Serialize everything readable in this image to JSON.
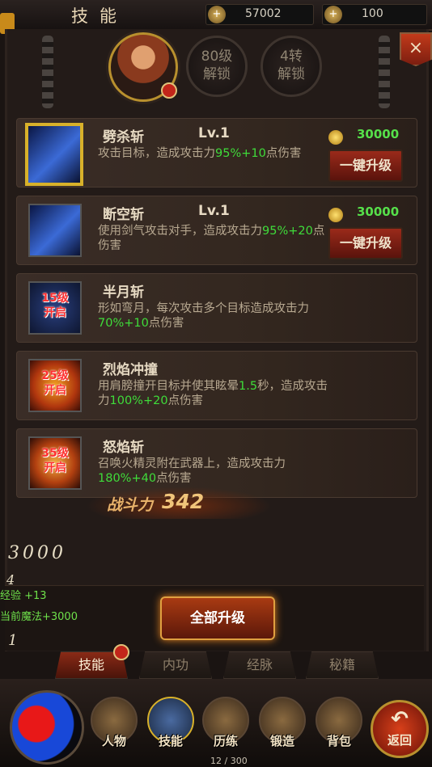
{
  "header": {
    "title": "技能",
    "gold": "57002",
    "ingot": "100",
    "add_sign": "+"
  },
  "hero": {
    "unlock_level": [
      "80级",
      "解锁"
    ],
    "unlock_rebirth": [
      "4转",
      "解锁"
    ],
    "close": "×"
  },
  "skills": [
    {
      "name": "劈杀斩",
      "level": "Lv.1",
      "desc_parts": [
        "攻击目标，造成攻击力",
        "95%+10",
        "点伤害"
      ],
      "cost": "30000",
      "button": "一键升级"
    },
    {
      "name": "断空斩",
      "level": "Lv.1",
      "desc_parts": [
        "使用剑气攻击对手，造成攻击力",
        "95%+20",
        "点伤害"
      ],
      "cost": "30000",
      "button": "一键升级"
    },
    {
      "name": "半月斩",
      "lock": [
        "15级",
        "开启"
      ],
      "desc_parts": [
        "形如弯月，每次攻击多个目标造成攻击力",
        "70%+10",
        "点伤害"
      ]
    },
    {
      "name": "烈焰冲撞",
      "lock": [
        "25级",
        "开启"
      ],
      "desc_parts": [
        "用肩膀撞开目标并使其眩晕",
        "1.5",
        "秒，造成攻击力",
        "100%+20",
        "点伤害"
      ]
    },
    {
      "name": "怒焰斩",
      "lock": [
        "35级",
        "开启"
      ],
      "desc_parts": [
        "召唤火精灵附在武器上，造成攻击力",
        "180%+40",
        "点伤害"
      ]
    }
  ],
  "power": {
    "label": "战斗力",
    "value": "342"
  },
  "floating": {
    "num1": "3000",
    "num2": "4",
    "exp": "经验 +13",
    "mana": "当前魔法+3000",
    "num3": "1"
  },
  "upgrade_all": "全部升级",
  "tabs": [
    "技能",
    "内功",
    "经脉",
    "秘籍"
  ],
  "nav": [
    "人物",
    "技能",
    "历练",
    "锻造",
    "背包"
  ],
  "back": "返回",
  "page_counter": "12 / 300"
}
